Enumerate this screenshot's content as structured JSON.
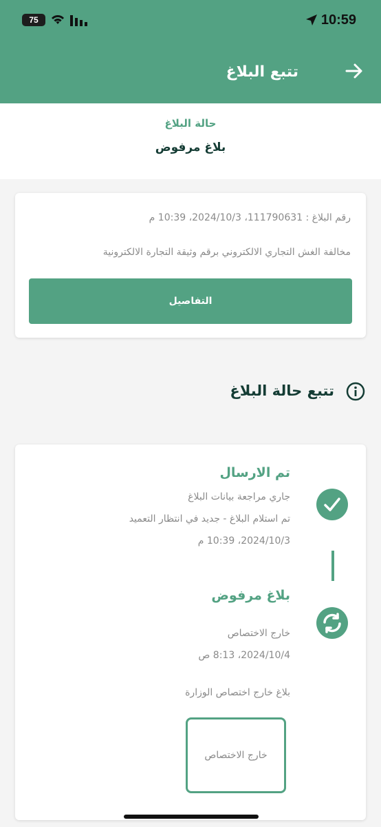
{
  "status_bar": {
    "time": "10:59",
    "battery": "75"
  },
  "header": {
    "title": "تتبع البلاغ"
  },
  "report_status": {
    "label": "حالة البلاغ",
    "value": "بلاغ مرفوض"
  },
  "report_card": {
    "meta": "رقم البلاغ : 111790631، 2024/10/3، 10:39 م",
    "description": "مخالفة الغش التجاري الالكتروني برقم وثيقة التجارة الالكترونية",
    "details_label": "التفاصيل"
  },
  "tracking": {
    "heading": "تتبع حالة البلاغ",
    "steps": [
      {
        "title": "تم الارسال",
        "lines": [
          "جاري مراجعة بيانات البلاغ",
          "تم استلام البلاغ - جديد في انتظار التعميد",
          "2024/10/3، 10:39 م"
        ],
        "icon": "check-icon"
      },
      {
        "title": "بلاغ مرفوض",
        "lines": [
          "خارج الاختصاص",
          "2024/10/4، 8:13 ص"
        ],
        "icon": "refresh-icon"
      }
    ],
    "note": "بلاغ خارج اختصاص الوزارة",
    "jurisdiction_box": "خارج الاختصاص"
  },
  "colors": {
    "primary": "#53a283",
    "dark_text": "#143c34",
    "muted_text": "#8a8a8a"
  }
}
